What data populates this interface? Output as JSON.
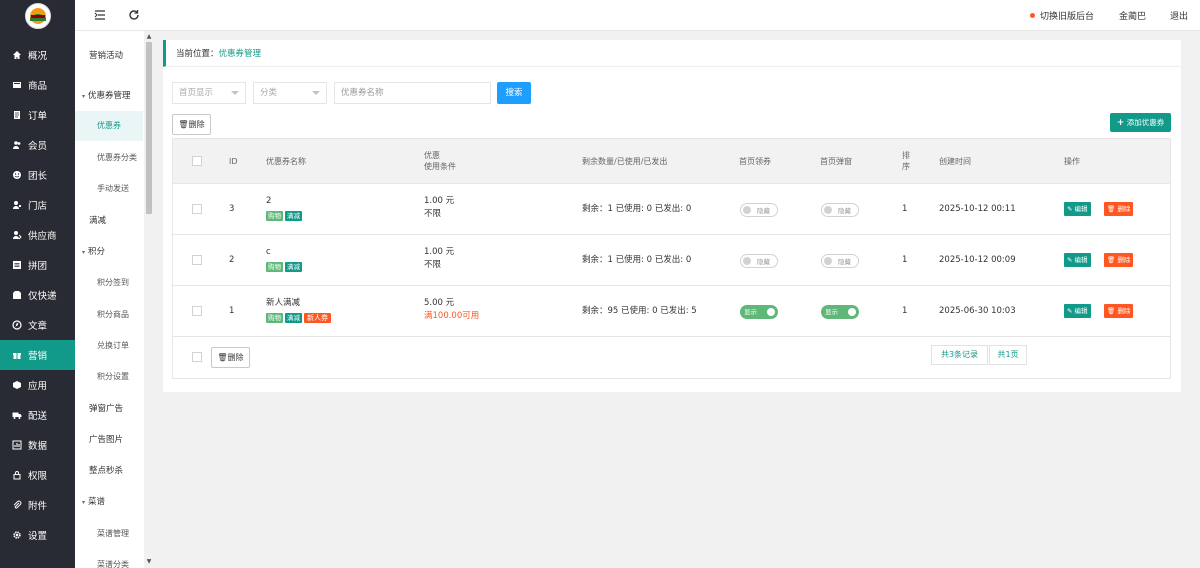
{
  "left_nav": {
    "items": [
      {
        "label": "概况",
        "icon": "home-icon"
      },
      {
        "label": "商品",
        "icon": "goods-icon"
      },
      {
        "label": "订单",
        "icon": "order-icon"
      },
      {
        "label": "会员",
        "icon": "users-icon"
      },
      {
        "label": "团长",
        "icon": "leader-icon"
      },
      {
        "label": "门店",
        "icon": "store-icon"
      },
      {
        "label": "供应商",
        "icon": "supplier-icon"
      },
      {
        "label": "拼团",
        "icon": "group-buy-icon"
      },
      {
        "label": "仅快递",
        "icon": "express-icon"
      },
      {
        "label": "文章",
        "icon": "article-icon"
      },
      {
        "label": "营销",
        "icon": "gift-icon"
      },
      {
        "label": "应用",
        "icon": "app-icon"
      },
      {
        "label": "配送",
        "icon": "truck-icon"
      },
      {
        "label": "数据",
        "icon": "data-icon"
      },
      {
        "label": "权限",
        "icon": "lock-icon"
      },
      {
        "label": "附件",
        "icon": "paperclip-icon"
      },
      {
        "label": "设置",
        "icon": "settings-icon"
      }
    ],
    "active_index": 10
  },
  "sub_nav": {
    "items": [
      {
        "label": "营销活动"
      },
      {
        "label": "优惠券管理"
      },
      {
        "label": "优惠券"
      },
      {
        "label": "优惠券分类"
      },
      {
        "label": "手动发送"
      },
      {
        "label": "满减"
      },
      {
        "label": "积分"
      },
      {
        "label": "积分签到"
      },
      {
        "label": "积分商品"
      },
      {
        "label": "兑换订单"
      },
      {
        "label": "积分设置"
      },
      {
        "label": "弹窗广告"
      },
      {
        "label": "广告图片"
      },
      {
        "label": "整点秒杀"
      },
      {
        "label": "菜谱"
      },
      {
        "label": "菜谱管理"
      },
      {
        "label": "菜谱分类"
      }
    ]
  },
  "topbar": {
    "switch_old": "切换旧版后台",
    "user": "金蔺巴",
    "logout": "退出",
    "menu_icon": "menu-fold-icon",
    "refresh_icon": "refresh-icon"
  },
  "breadcrumb": {
    "prefix": "当前位置：",
    "current": "优惠券管理"
  },
  "filters": {
    "home_display_placeholder": "首页显示",
    "category_placeholder": "分类",
    "name_placeholder": "优惠券名称",
    "search_label": "搜索"
  },
  "actions": {
    "delete_label": "删除",
    "add_label": "添加优惠券"
  },
  "table": {
    "headers": {
      "id": "ID",
      "name": "优惠券名称",
      "cond_line1": "优惠",
      "cond_line2": "使用条件",
      "qty": "剩余数量/已使用/已发出",
      "home_coupon": "首页领券",
      "home_popup": "首页弹窗",
      "sort_line1": "排",
      "sort_line2": "序",
      "created": "创建时间",
      "ops": "操作"
    },
    "rows": [
      {
        "id": "3",
        "name": "2",
        "tags": [
          "购物",
          "满减"
        ],
        "amount": "1.00 元",
        "cond": "不限",
        "qty": "剩余：1   已使用: 0   已发出: 0",
        "home_coupon": "隐藏",
        "home_popup": "隐藏",
        "sort": "1",
        "created": "2025-10-12 00:11"
      },
      {
        "id": "2",
        "name": "c",
        "tags": [
          "购物",
          "满减"
        ],
        "amount": "1.00 元",
        "cond": "不限",
        "qty": "剩余：1   已使用: 0   已发出: 0",
        "home_coupon": "隐藏",
        "home_popup": "隐藏",
        "sort": "1",
        "created": "2025-10-12 00:09"
      },
      {
        "id": "1",
        "name": "新人满减",
        "tags": [
          "购物",
          "满减",
          "新人券"
        ],
        "amount": "5.00 元",
        "cond": "满100.00可用",
        "qty": "剩余：95   已使用: 0   已发出: 5",
        "home_coupon": "显示",
        "home_popup": "显示",
        "sort": "1",
        "created": "2025-06-30 10:03"
      }
    ],
    "edit_label": "编辑",
    "del_label": "删除"
  },
  "pagination": {
    "total": "共3条记录",
    "pages": "共1页"
  },
  "colors": {
    "sidebar_bg": "#282b33",
    "accent": "#11998a",
    "search_blue": "#1e9fff",
    "danger": "#ff5722",
    "toggle_on": "#5fb878"
  }
}
